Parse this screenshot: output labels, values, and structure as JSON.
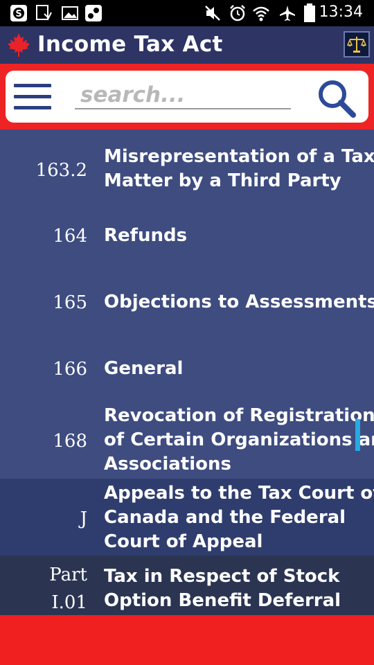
{
  "status": {
    "time": "13:34"
  },
  "app": {
    "title": "Income Tax Act"
  },
  "search": {
    "placeholder": "search..."
  },
  "items": [
    {
      "num": "163.2",
      "title_lines": [
        "Misrepresentation of a Tax",
        "Matter by a Third Party"
      ]
    },
    {
      "num": "164",
      "title_lines": [
        "Refunds"
      ]
    },
    {
      "num": "165",
      "title_lines": [
        "Objections to Assessments"
      ]
    },
    {
      "num": "166",
      "title_lines": [
        "General"
      ]
    },
    {
      "num": "168",
      "title_lines": [
        "Revocation of Registration",
        "of Certain Organizations and",
        "Associations"
      ]
    },
    {
      "num": "J",
      "title_lines": [
        "Appeals to the Tax Court of",
        "Canada and the Federal",
        "Court of Appeal"
      ]
    },
    {
      "num_lines": [
        "Part",
        "I.01"
      ],
      "title_lines": [
        "Tax in Respect of Stock",
        "Option Benefit Deferral"
      ]
    }
  ],
  "colors": {
    "row_blue": "#3e4c80",
    "row_dark_blue": "#2f3d6e",
    "row_gray": "#2b3552",
    "accent_red": "#ee2424",
    "appbar": "#2e3464"
  }
}
